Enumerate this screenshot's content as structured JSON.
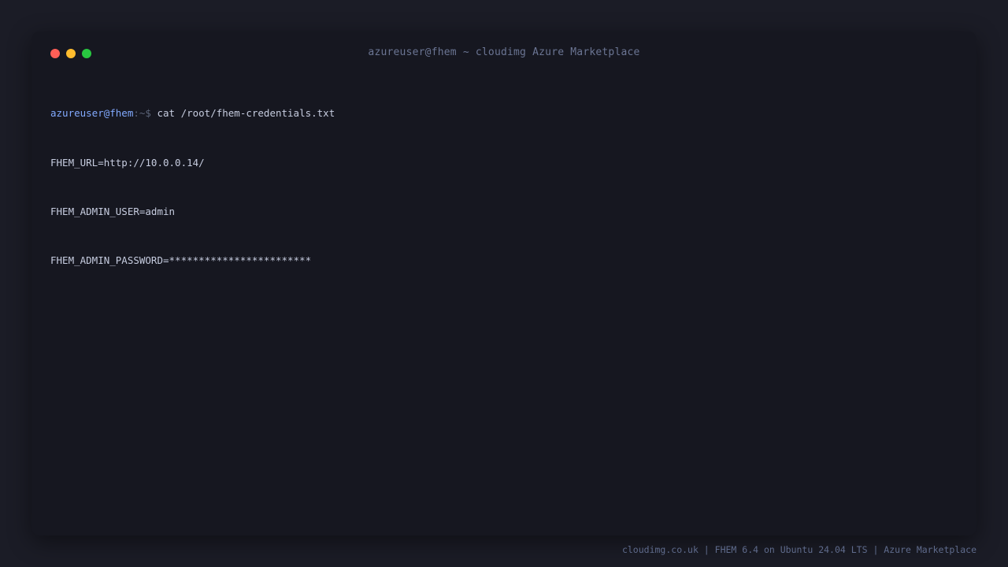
{
  "window": {
    "title": "azureuser@fhem ~ cloudimg Azure Marketplace"
  },
  "terminal": {
    "prompt_user_host": "azureuser@fhem",
    "prompt_path_symbol": ":~$ ",
    "command": "cat /root/fhem-credentials.txt",
    "output_lines": [
      "FHEM_URL=http://10.0.0.14/",
      "FHEM_ADMIN_USER=admin",
      "FHEM_ADMIN_PASSWORD=************************"
    ]
  },
  "footer": {
    "text": "cloudimg.co.uk | FHEM 6.4 on Ubuntu 24.04 LTS | Azure Marketplace"
  },
  "colors": {
    "page_background": "#1b1c26",
    "window_background": "#161720",
    "close": "#ff5f57",
    "minimize": "#febc2e",
    "maximize": "#28c840",
    "prompt_user": "#82aaff",
    "text": "#c6ccdf",
    "muted": "#6b7593"
  }
}
